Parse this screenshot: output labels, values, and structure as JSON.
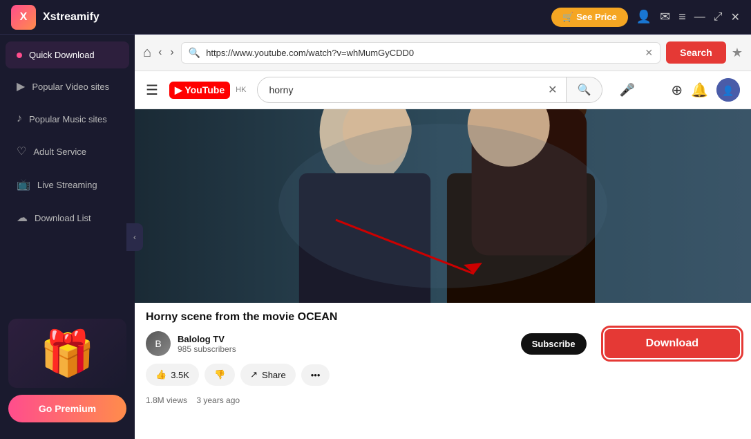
{
  "app": {
    "name": "Xstreamify",
    "logo_char": "X"
  },
  "topbar": {
    "see_price_label": "🛒 See Price",
    "icon_user": "👤",
    "icon_mail": "✉",
    "icon_menu": "≡",
    "icon_resize": "⤢",
    "icon_close": "✕"
  },
  "sidebar": {
    "collapse_icon": "‹",
    "items": [
      {
        "id": "quick-download",
        "label": "Quick Download",
        "icon": "⬇",
        "active": true
      },
      {
        "id": "popular-video",
        "label": "Popular Video sites",
        "icon": "▶",
        "active": false
      },
      {
        "id": "popular-music",
        "label": "Popular Music sites",
        "icon": "♪",
        "active": false
      },
      {
        "id": "adult-service",
        "label": "Adult Service",
        "icon": "♡",
        "active": false
      },
      {
        "id": "live-streaming",
        "label": "Live Streaming",
        "icon": "📺",
        "active": false
      },
      {
        "id": "download-list",
        "label": "Download List",
        "icon": "☁",
        "active": false
      }
    ],
    "promo_emoji": "🎁",
    "go_premium_label": "Go Premium"
  },
  "navbar": {
    "home_icon": "⌂",
    "back_icon": "‹",
    "forward_icon": "›",
    "url": "https://www.youtube.com/watch?v=whMumGyCDD0",
    "url_icon": "🔍",
    "clear_icon": "✕",
    "search_label": "Search",
    "bookmark_icon": "★"
  },
  "youtube": {
    "menu_icon": "☰",
    "logo_text": "YouTube",
    "logo_hk": "HK",
    "search_query": "horny",
    "clear_icon": "✕",
    "search_icon": "🔍",
    "mic_icon": "🎤",
    "add_icon": "⊕",
    "bell_icon": "🔔",
    "subscribe_label": "Subscribe",
    "video_title": "Horny scene from the movie OCEAN",
    "channel_name": "Balolog TV",
    "channel_subs": "985 subscribers",
    "like_count": "3.5K",
    "share_label": "Share",
    "views": "1.8M views",
    "time_ago": "3 years ago",
    "download_label": "Download"
  }
}
